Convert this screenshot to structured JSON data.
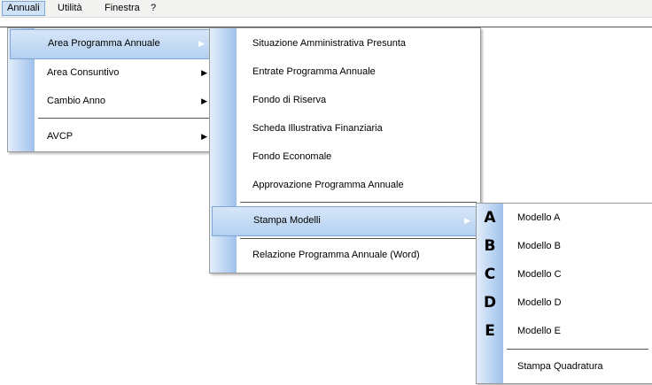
{
  "menubar": {
    "items": [
      "Annuali",
      "Utilità",
      "Finestra",
      "?"
    ]
  },
  "menu_annuali": {
    "items": [
      {
        "label": "Area Programma Annuale",
        "submenu": true
      },
      {
        "label": "Area Consuntivo",
        "submenu": true
      },
      {
        "label": "Cambio Anno",
        "submenu": true
      },
      {
        "label": "AVCP",
        "submenu": true
      }
    ]
  },
  "menu_area_programma": {
    "items": [
      "Situazione Amministrativa Presunta",
      "Entrate Programma Annuale",
      "Fondo di Riserva",
      "Scheda Illustrativa Finanziaria",
      "Fondo Economale",
      "Approvazione Programma Annuale",
      "Stampa Modelli",
      "Relazione Programma Annuale (Word)"
    ]
  },
  "menu_stampa_modelli": {
    "items": [
      {
        "icon": "A",
        "label": "Modello A"
      },
      {
        "icon": "B",
        "label": "Modello B"
      },
      {
        "icon": "C",
        "label": "Modello C"
      },
      {
        "icon": "D",
        "label": "Modello D"
      },
      {
        "icon": "E",
        "label": "Modello E"
      },
      {
        "icon": "",
        "label": "Stampa Quadratura"
      }
    ]
  },
  "arrow_glyph": "▶",
  "colors": {
    "highlight": "#b4d0f0",
    "highlight_border": "#7ea6d6",
    "gutter": "#a9c8ee"
  }
}
